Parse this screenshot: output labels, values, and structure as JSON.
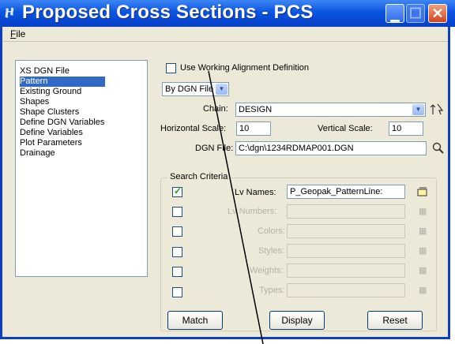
{
  "window": {
    "title": "Proposed Cross Sections - PCS"
  },
  "menu": {
    "file": "File"
  },
  "nav": {
    "items": [
      {
        "label": "XS DGN File",
        "selected": false
      },
      {
        "label": "Pattern",
        "selected": true
      },
      {
        "label": "Existing Ground",
        "selected": false
      },
      {
        "label": "Shapes",
        "selected": false
      },
      {
        "label": "Shape Clusters",
        "selected": false
      },
      {
        "label": "Define DGN Variables",
        "selected": false
      },
      {
        "label": "Define Variables",
        "selected": false
      },
      {
        "label": "Plot Parameters",
        "selected": false
      },
      {
        "label": "Drainage",
        "selected": false
      }
    ]
  },
  "pattern": {
    "use_working_alignment_label": "Use Working Alignment Definition",
    "use_working_alignment_checked": false,
    "source_select": "By DGN File",
    "chain_label": "Chain:",
    "chain_value": "DESIGN",
    "horizontal_scale_label": "Horizontal Scale:",
    "horizontal_scale_value": "10",
    "vertical_scale_label": "Vertical Scale:",
    "vertical_scale_value": "10",
    "dgn_file_label": "DGN File:",
    "dgn_file_value": "C:\\dgn\\1234RDMAP001.DGN"
  },
  "search_criteria": {
    "title": "Search Criteria",
    "rows": [
      {
        "label": "Lv Names:",
        "value": "P_Geopak_PatternLine:",
        "checked": true,
        "enabled": true
      },
      {
        "label": "Lv Numbers:",
        "value": "",
        "checked": false,
        "enabled": false
      },
      {
        "label": "Colors:",
        "value": "",
        "checked": false,
        "enabled": false
      },
      {
        "label": "Styles:",
        "value": "",
        "checked": false,
        "enabled": false
      },
      {
        "label": "Weights:",
        "value": "",
        "checked": false,
        "enabled": false
      },
      {
        "label": "Types:",
        "value": "",
        "checked": false,
        "enabled": false
      }
    ]
  },
  "buttons": {
    "match": "Match",
    "display": "Display",
    "reset": "Reset"
  },
  "colors": {
    "titlebar": "#0a55e0",
    "selection": "#316ac5",
    "face": "#ece9d8"
  }
}
